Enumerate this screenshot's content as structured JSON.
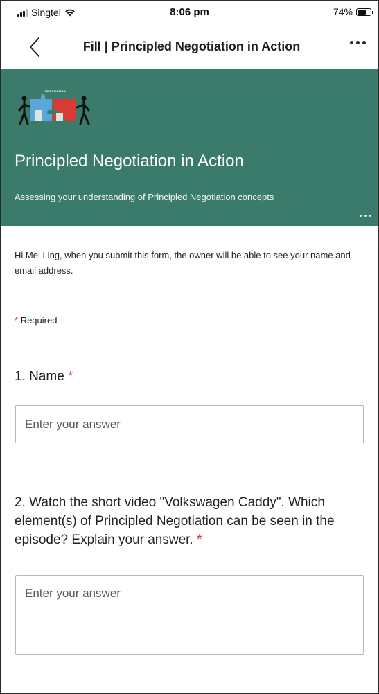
{
  "status_bar": {
    "carrier": "Singtel",
    "time": "8:06 pm",
    "battery_percent_label": "74%",
    "battery_level": 0.74
  },
  "nav": {
    "title": "Fill | Principled Negotiation in Action"
  },
  "banner": {
    "logo_text": "NEGOTIATION",
    "title": "Principled Negotiation in Action",
    "subtitle": "Assessing your understanding of Principled Negotiation concepts",
    "background_color": "#3a7b6c"
  },
  "form": {
    "notice": "Hi Mei Ling, when you submit this form, the owner will be able to see your name and email address.",
    "required_marker": "*",
    "required_label": "Required",
    "questions": [
      {
        "number": "1.",
        "text": "Name",
        "required_marker": "*",
        "placeholder": "Enter your answer"
      },
      {
        "number": "2.",
        "text": "Watch the short video \"Volkswagen Caddy\". Which element(s) of Principled Negotiation can be seen in the episode? Explain your answer.",
        "required_marker": "*",
        "placeholder": "Enter your answer"
      }
    ]
  },
  "icons": {
    "back": "chevron-left-icon",
    "more": "more-horizontal-icon",
    "banner_more": "more-horizontal-icon",
    "signal": "cellular-signal-icon",
    "wifi": "wifi-icon",
    "battery": "battery-icon",
    "logo": "negotiation-puzzle-logo"
  },
  "colors": {
    "accent": "#3a7b6c",
    "required": "#d32f2f"
  }
}
